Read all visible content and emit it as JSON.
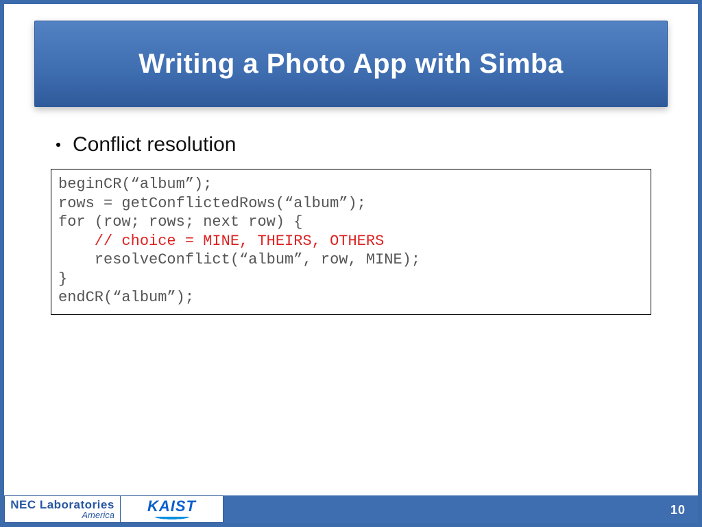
{
  "title": "Writing a Photo App with Simba",
  "bullet": "Conflict resolution",
  "code": {
    "l1": "beginCR(“album”);",
    "l2": "rows = getConflictedRows(“album”);",
    "l3": "for (row; rows; next row) {",
    "l4": "    // choice = MINE, THEIRS, OTHERS",
    "l5": "    resolveConflict(“album”, row, MINE);",
    "l6": "}",
    "l7": "endCR(“album”);"
  },
  "logos": {
    "nec_line1": "NEC Laboratories",
    "nec_line2": "America",
    "kaist": "KAIST"
  },
  "page_number": "10"
}
